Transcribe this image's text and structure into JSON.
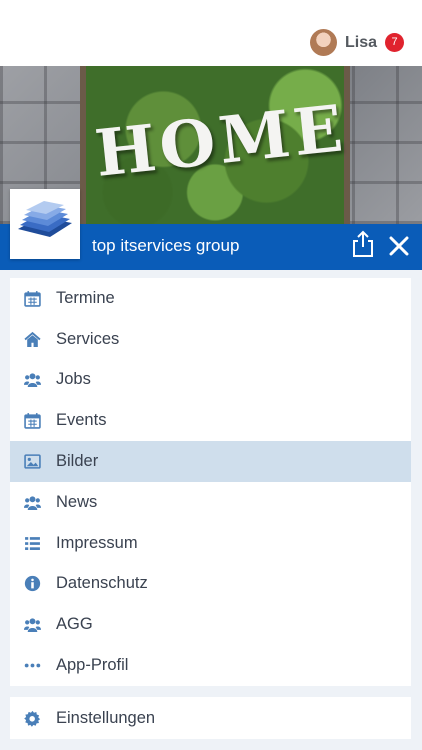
{
  "user": {
    "name": "Lisa",
    "notification_count": "7"
  },
  "hero": {
    "word": "HOME"
  },
  "brand": {
    "name": "top itservices group"
  },
  "menu": {
    "items": [
      {
        "label": "Termine",
        "icon": "calendar-icon"
      },
      {
        "label": "Services",
        "icon": "home-icon"
      },
      {
        "label": "Jobs",
        "icon": "users-icon"
      },
      {
        "label": "Events",
        "icon": "calendar-icon"
      },
      {
        "label": "Bilder",
        "icon": "image-icon",
        "active": true
      },
      {
        "label": "News",
        "icon": "users-icon"
      },
      {
        "label": "Impressum",
        "icon": "list-icon"
      },
      {
        "label": "Datenschutz",
        "icon": "info-icon"
      },
      {
        "label": "AGG",
        "icon": "users-icon"
      },
      {
        "label": "App-Profil",
        "icon": "ellipsis-icon"
      }
    ]
  },
  "settings": {
    "label": "Einstellungen",
    "icon": "gear-icon"
  },
  "colors": {
    "brand_blue": "#0a5cb8",
    "icon_blue": "#4a7fb8",
    "active_bg": "#cfdeec",
    "badge_red": "#e0232e"
  }
}
